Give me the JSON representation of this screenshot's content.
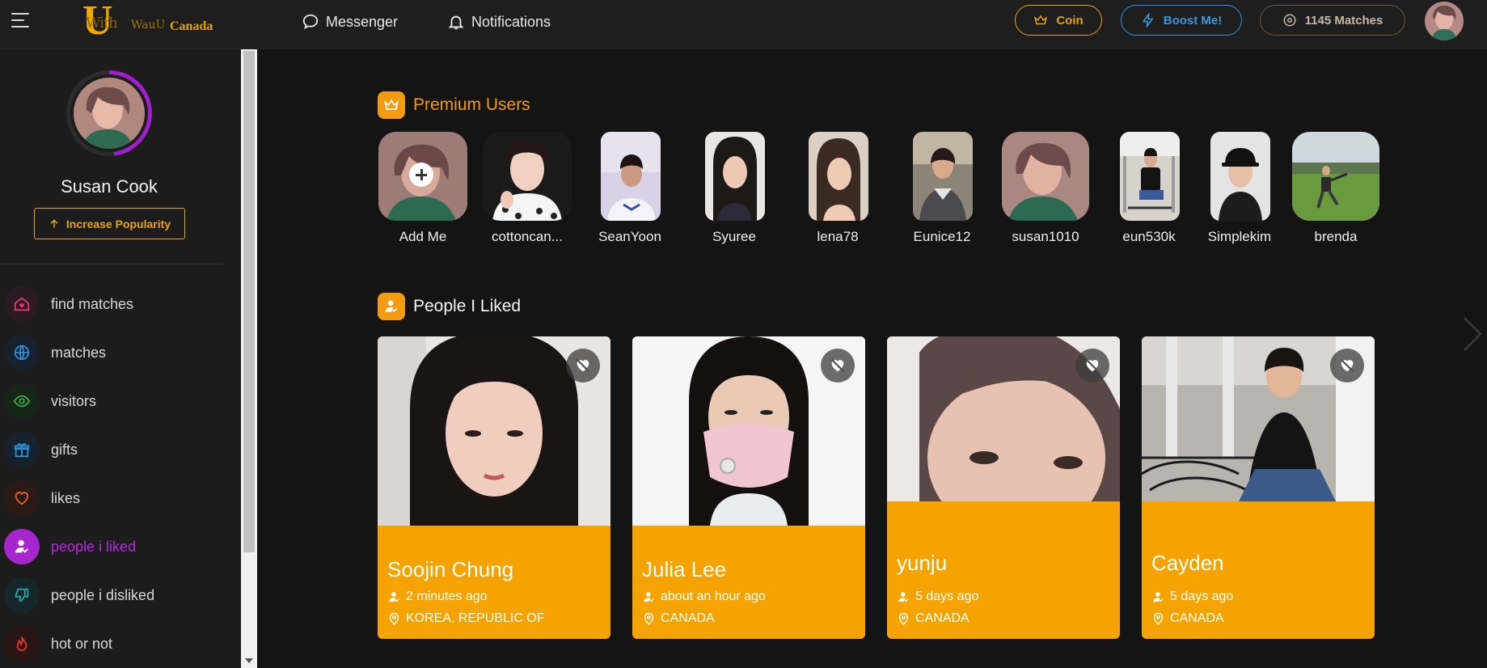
{
  "header": {
    "brand_prefix": "With",
    "brand_u": "U",
    "brand_middle": "WauU",
    "brand_suffix": "Canada",
    "messenger_label": "Messenger",
    "notifications_label": "Notifications",
    "coin_label": "Coin",
    "boost_label": "Boost Me!",
    "matches_label": "1145 Matches"
  },
  "profile": {
    "name": "Susan Cook",
    "popularity_label": "Increase Popularity"
  },
  "sidebar": {
    "items": [
      {
        "label": "find matches",
        "icon": "home-heart-icon",
        "color": "#e8357a"
      },
      {
        "label": "matches",
        "icon": "globe-icon",
        "color": "#2e8fd6"
      },
      {
        "label": "visitors",
        "icon": "eye-icon",
        "color": "#3aa845"
      },
      {
        "label": "gifts",
        "icon": "gift-icon",
        "color": "#2e8fd6"
      },
      {
        "label": "likes",
        "icon": "heart-icon",
        "color": "#f05a28"
      },
      {
        "label": "people i liked",
        "icon": "user-check-icon",
        "color": "#b42bd9"
      },
      {
        "label": "people i disliked",
        "icon": "thumbs-down-icon",
        "color": "#29a3a3"
      },
      {
        "label": "hot or not",
        "icon": "flame-icon",
        "color": "#e53935"
      }
    ]
  },
  "premium": {
    "title": "Premium Users",
    "users": [
      {
        "name": "Add Me"
      },
      {
        "name": "cottoncan..."
      },
      {
        "name": "SeanYoon"
      },
      {
        "name": "Syuree"
      },
      {
        "name": "lena78"
      },
      {
        "name": "Eunice12"
      },
      {
        "name": "susan1010"
      },
      {
        "name": "eun530k"
      },
      {
        "name": "Simplekim"
      },
      {
        "name": "brenda"
      }
    ]
  },
  "liked": {
    "title": "People I Liked",
    "cards": [
      {
        "name": "Soojin Chung",
        "time": "2 minutes ago",
        "location": "KOREA, REPUBLIC OF"
      },
      {
        "name": "Julia Lee",
        "time": "about an hour ago",
        "location": "CANADA"
      },
      {
        "name": "yunju",
        "time": "5 days ago",
        "location": "CANADA"
      },
      {
        "name": "Cayden",
        "time": "5 days ago",
        "location": "CANADA"
      }
    ]
  },
  "colors": {
    "accent": "#f39c12",
    "coin": "#e6a219",
    "boost": "#2f8fd8",
    "active_purple": "#b42bd9"
  }
}
